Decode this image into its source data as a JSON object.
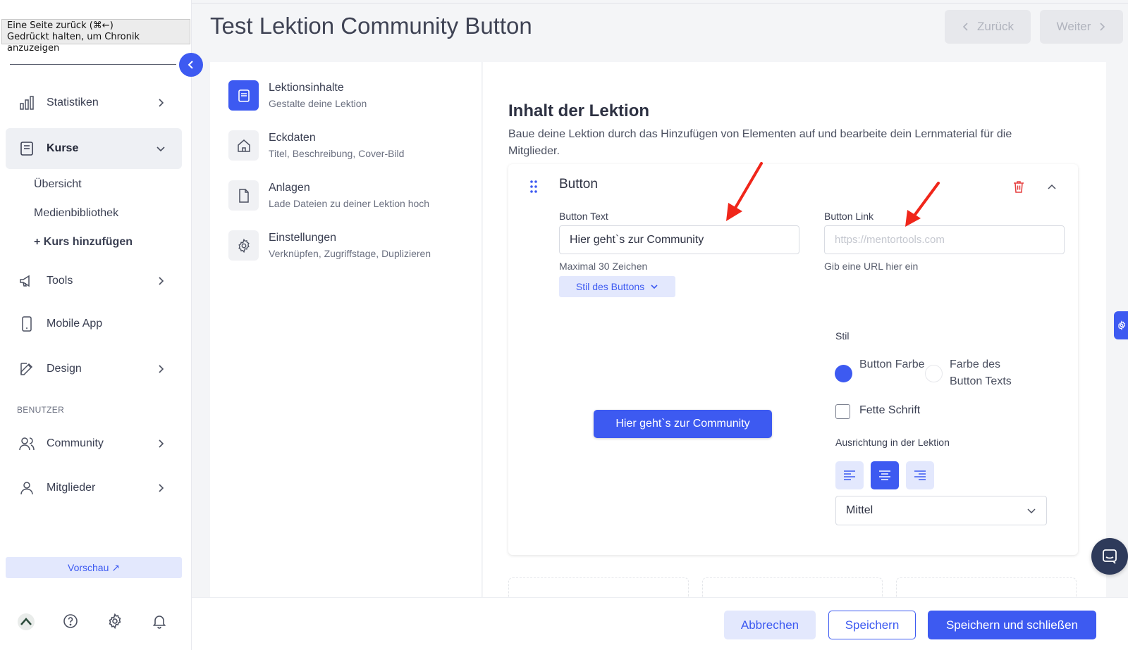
{
  "tooltip": {
    "line1": "Eine Seite zurück (⌘←)",
    "line2": "Gedrückt halten, um Chronik anzuzeigen"
  },
  "sidebar": {
    "items": [
      {
        "label": "Statistiken",
        "icon": "bar-chart-icon"
      },
      {
        "label": "Kurse",
        "icon": "book-icon",
        "active": true
      },
      {
        "label": "Tools",
        "icon": "megaphone-icon"
      },
      {
        "label": "Mobile App",
        "icon": "phone-icon"
      },
      {
        "label": "Design",
        "icon": "pencil-icon"
      },
      {
        "label": "Community",
        "icon": "users-icon"
      },
      {
        "label": "Mitglieder",
        "icon": "user-icon"
      }
    ],
    "sub_items": [
      "Übersicht",
      "Medienbibliothek",
      "+ Kurs hinzufügen"
    ],
    "section_label": "BENUTZER",
    "preview_label": "Vorschau ↗"
  },
  "header": {
    "title": "Test Lektion Community Button",
    "back_label": "Zurück",
    "next_label": "Weiter"
  },
  "steps": [
    {
      "title": "Lektionsinhalte",
      "subtitle": "Gestalte deine Lektion",
      "icon": "document-icon",
      "active": true
    },
    {
      "title": "Eckdaten",
      "subtitle": "Titel, Beschreibung, Cover-Bild",
      "icon": "home-icon"
    },
    {
      "title": "Anlagen",
      "subtitle": "Lade Dateien zu deiner Lektion hoch",
      "icon": "file-icon"
    },
    {
      "title": "Einstellungen",
      "subtitle": "Verknüpfen, Zugriffstage, Duplizieren",
      "icon": "gear-icon"
    }
  ],
  "content": {
    "title": "Inhalt der Lektion",
    "description": "Baue deine Lektion durch das Hinzufügen von Elementen auf und bearbeite dein Lernmaterial für die Mitglieder."
  },
  "button_card": {
    "title": "Button",
    "text_label": "Button Text",
    "text_value": "Hier geht`s zur Community",
    "text_help": "Maximal 30 Zeichen",
    "link_label": "Button Link",
    "link_placeholder": "https://mentortools.com",
    "link_help": "Gib eine URL hier ein",
    "style_toggle_label": "Stil des Buttons",
    "preview_label": "Hier geht`s zur Community",
    "style_label": "Stil",
    "radio_button_color": "Button Farbe",
    "radio_text_color": "Farbe des Button Texts",
    "bold_label": "Fette Schrift",
    "alignment_label": "Ausrichtung in der Lektion",
    "alignment_selected": "center",
    "size_value": "Mittel"
  },
  "footer": {
    "cancel_label": "Abbrechen",
    "save_label": "Speichern",
    "save_close_label": "Speichern und schließen"
  },
  "colors": {
    "accent": "#3d5af1",
    "accent_light": "#e3e8fd",
    "annotation_arrow": "#f0261a"
  }
}
